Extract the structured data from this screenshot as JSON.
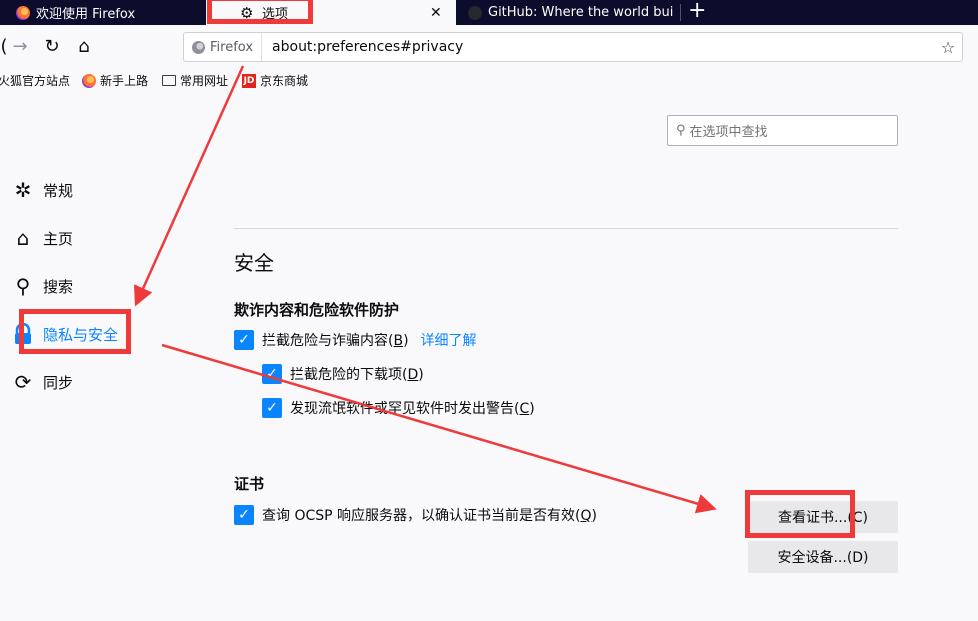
{
  "tabs": [
    {
      "title": "欢迎使用 Firefox",
      "icon": "firefox-icon"
    },
    {
      "title": "选项",
      "icon": "gear-icon"
    },
    {
      "title": "GitHub: Where the world bui",
      "icon": "github-icon"
    }
  ],
  "new_tab_symbol": "+",
  "close_symbol": "✕",
  "navbar": {
    "identity_label": "Firefox",
    "url": "about:preferences#privacy"
  },
  "bookmarks": [
    {
      "label": "火狐官方站点",
      "icon": "firefox-icon"
    },
    {
      "label": "新手上路",
      "icon": "firefox-icon"
    },
    {
      "label": "常用网址",
      "icon": "folder-icon"
    },
    {
      "label": "京东商城",
      "icon": "jd-icon",
      "icon_text": "JD"
    }
  ],
  "search": {
    "placeholder": "在选项中查找"
  },
  "sidebar": [
    {
      "label": "常规",
      "icon": "gear-icon"
    },
    {
      "label": "主页",
      "icon": "home-icon"
    },
    {
      "label": "搜索",
      "icon": "search-icon"
    },
    {
      "label": "隐私与安全",
      "icon": "lock-icon",
      "selected": true
    },
    {
      "label": "同步",
      "icon": "sync-icon"
    }
  ],
  "section": {
    "title": "安全",
    "fraud_heading": "欺诈内容和危险软件防护",
    "block_dangerous": {
      "text": "拦截危险与诈骗内容(",
      "key": "B",
      "tail": ")",
      "checked": true
    },
    "learn_more": "详细了解",
    "block_downloads": {
      "text": "拦截危险的下载项(",
      "key": "D",
      "tail": ")",
      "checked": true
    },
    "warn_unwanted": {
      "text": "发现流氓软件或罕见软件时发出警告(",
      "key": "C",
      "tail": ")",
      "checked": true
    },
    "cert_heading": "证书",
    "ocsp": {
      "text": "查询 OCSP 响应服务器，以确认证书当前是否有效(",
      "key": "Q",
      "tail": ")",
      "checked": true
    },
    "view_certs_button": "查看证书...(C)",
    "security_devices_button": "安全设备...(D)"
  },
  "colors": {
    "accent": "#0a84ff",
    "annotation": "#ef3a3a",
    "tabstrip": "#0c0c2d"
  }
}
